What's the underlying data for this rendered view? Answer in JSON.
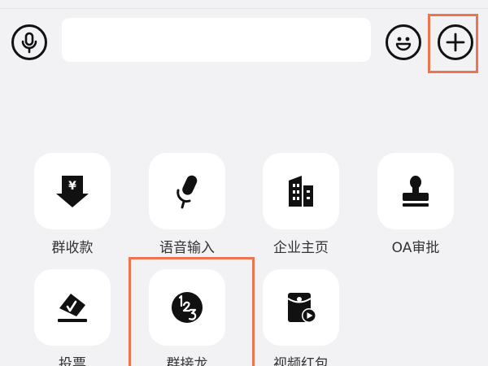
{
  "input_bar": {
    "voice_icon": "microphone-icon",
    "text_value": "",
    "emoji_icon": "smiley-icon",
    "more_icon": "plus-circle-icon"
  },
  "tools": [
    {
      "label": "群收款",
      "icon": "yuan-download-icon"
    },
    {
      "label": "语音输入",
      "icon": "microphone-tilted-icon"
    },
    {
      "label": "企业主页",
      "icon": "building-icon"
    },
    {
      "label": "OA审批",
      "icon": "stamp-icon"
    },
    {
      "label": "投票",
      "icon": "ballot-box-icon"
    },
    {
      "label": "群接龙",
      "icon": "number-123-icon"
    },
    {
      "label": "视频红包",
      "icon": "video-red-packet-icon"
    }
  ],
  "colors": {
    "background": "#f2f2f4",
    "tile": "#ffffff",
    "icon": "#111111",
    "label": "#333333",
    "highlight": "#ec7550"
  }
}
